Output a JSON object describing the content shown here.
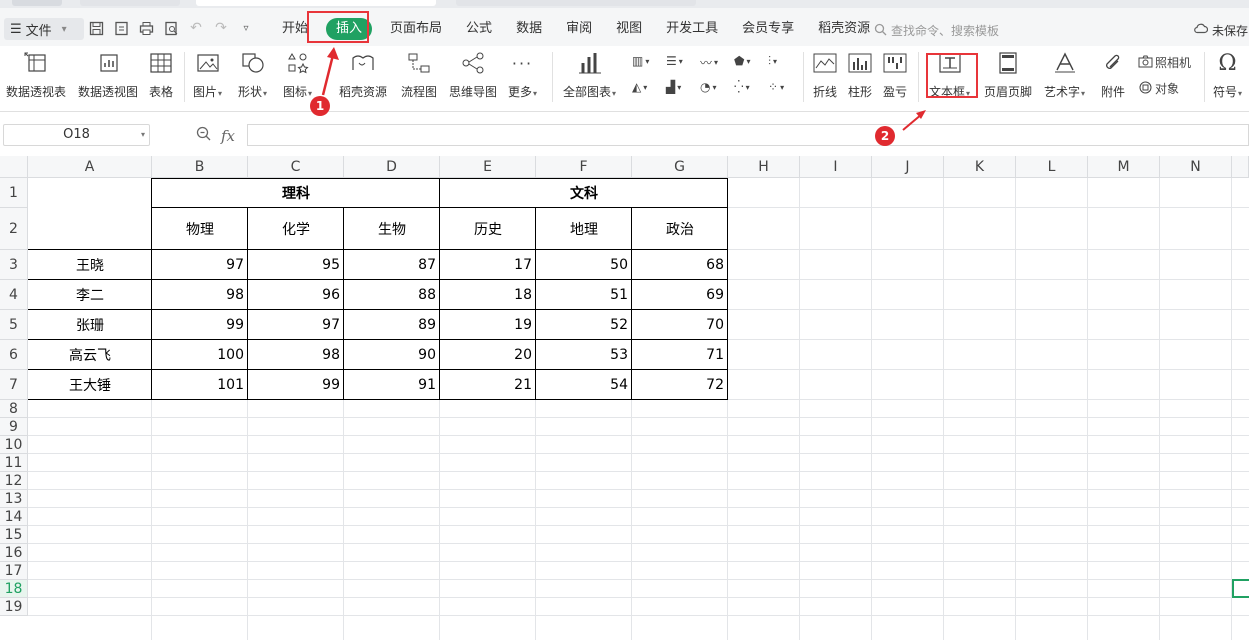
{
  "menubar": {
    "file_label": "文件",
    "tabs": [
      "开始",
      "插入",
      "页面布局",
      "公式",
      "数据",
      "审阅",
      "视图",
      "开发工具",
      "会员专享",
      "稻壳资源"
    ],
    "active_tab": "插入",
    "search_placeholder": "查找命令、搜索模板",
    "save_status": "未保存"
  },
  "ribbon": {
    "pivot_table": "数据透视表",
    "pivot_chart": "数据透视图",
    "table": "表格",
    "picture": "图片",
    "shape": "形状",
    "icon": "图标",
    "docer_resources": "稻壳资源",
    "flowchart": "流程图",
    "mindmap": "思维导图",
    "more": "更多",
    "all_charts": "全部图表",
    "line": "折线",
    "column": "柱形",
    "win_loss": "盈亏",
    "textbox": "文本框",
    "header_footer": "页眉页脚",
    "wordart": "艺术字",
    "attachment": "附件",
    "camera": "照相机",
    "object": "对象",
    "symbol": "符号"
  },
  "formula_bar": {
    "name_box": "O18",
    "fx": "fx",
    "formula": ""
  },
  "annotations": {
    "badge1": "1",
    "badge2": "2"
  },
  "sheet": {
    "columns": [
      "A",
      "B",
      "C",
      "D",
      "E",
      "F",
      "G",
      "H",
      "I",
      "J",
      "K",
      "L",
      "M",
      "N"
    ],
    "rows": [
      "1",
      "2",
      "3",
      "4",
      "5",
      "6",
      "7",
      "8",
      "9",
      "10",
      "11",
      "12",
      "13",
      "14",
      "15",
      "16",
      "17",
      "18",
      "19"
    ],
    "selected_row": "18",
    "group_headers": [
      "理科",
      "文科"
    ],
    "subjects": [
      "物理",
      "化学",
      "生物",
      "历史",
      "地理",
      "政治"
    ],
    "students": [
      {
        "name": "王晓",
        "scores": [
          "97",
          "95",
          "87",
          "17",
          "50",
          "68"
        ]
      },
      {
        "name": "李二",
        "scores": [
          "98",
          "96",
          "88",
          "18",
          "51",
          "69"
        ]
      },
      {
        "name": "张珊",
        "scores": [
          "99",
          "97",
          "89",
          "19",
          "52",
          "70"
        ]
      },
      {
        "name": "高云飞",
        "scores": [
          "100",
          "98",
          "90",
          "20",
          "53",
          "71"
        ]
      },
      {
        "name": "王大锤",
        "scores": [
          "101",
          "99",
          "91",
          "21",
          "54",
          "72"
        ]
      }
    ]
  },
  "colors": {
    "accent": "#20a162",
    "annotation": "#e02a2f"
  }
}
